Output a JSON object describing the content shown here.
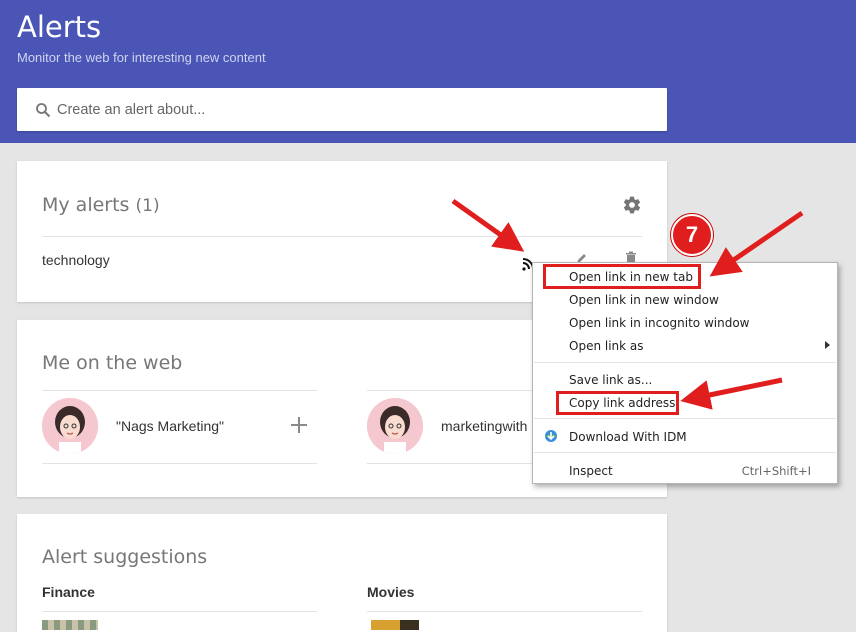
{
  "header": {
    "title": "Alerts",
    "subtitle": "Monitor the web for interesting new content",
    "search_placeholder": "Create an alert about..."
  },
  "my_alerts": {
    "title": "My alerts",
    "count": "(1)",
    "items": [
      {
        "label": "technology"
      }
    ]
  },
  "web": {
    "title": "Me on the web",
    "profiles": [
      {
        "name": "\"Nags Marketing\""
      },
      {
        "name": "marketingwith"
      }
    ]
  },
  "suggestions": {
    "title": "Alert suggestions",
    "categories": [
      {
        "label": "Finance"
      },
      {
        "label": "Movies"
      }
    ]
  },
  "context_menu": {
    "items": [
      {
        "label": "Open link in new tab"
      },
      {
        "label": "Open link in new window"
      },
      {
        "label": "Open link in incognito window"
      },
      {
        "label": "Open link as"
      },
      {
        "label": "Save link as..."
      },
      {
        "label": "Copy link address"
      },
      {
        "label": "Download With IDM"
      },
      {
        "label": "Inspect",
        "shortcut": "Ctrl+Shift+I"
      }
    ]
  },
  "annotation": {
    "step": "7"
  },
  "colors": {
    "header": "#4a55b5",
    "highlight": "#e01e1e"
  }
}
